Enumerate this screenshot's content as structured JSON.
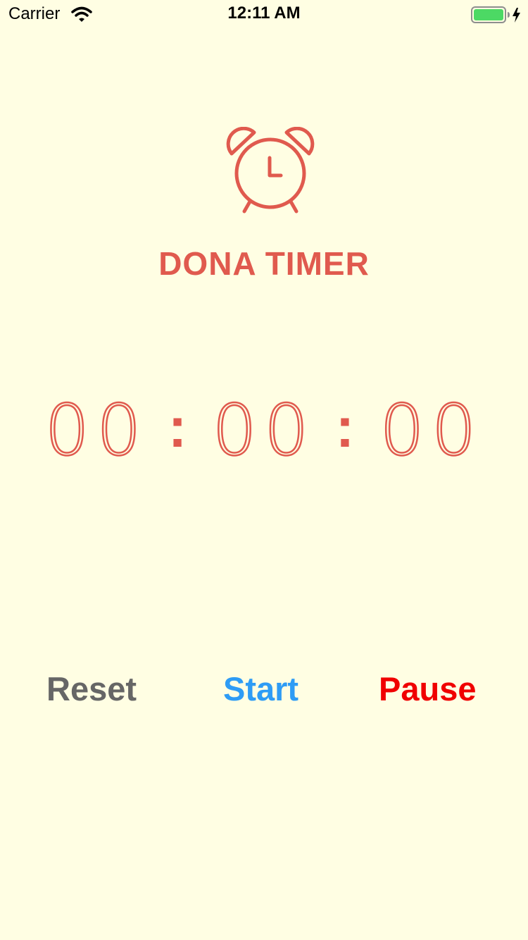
{
  "status_bar": {
    "carrier": "Carrier",
    "time": "12:11 AM",
    "wifi_icon": "wifi-icon",
    "battery_icon": "battery-charging-icon",
    "battery_color": "#4CD964"
  },
  "app": {
    "icon": "alarm-clock-icon",
    "title": "DONA TIMER",
    "accent_color": "#E05A4E"
  },
  "timer": {
    "hours": "00",
    "minutes": "00",
    "seconds": "00",
    "separator": ":"
  },
  "buttons": {
    "reset": {
      "label": "Reset",
      "color": "#666666"
    },
    "start": {
      "label": "Start",
      "color": "#2E9CF5"
    },
    "pause": {
      "label": "Pause",
      "color": "#F00000"
    }
  },
  "background_color": "#FFFEE3"
}
